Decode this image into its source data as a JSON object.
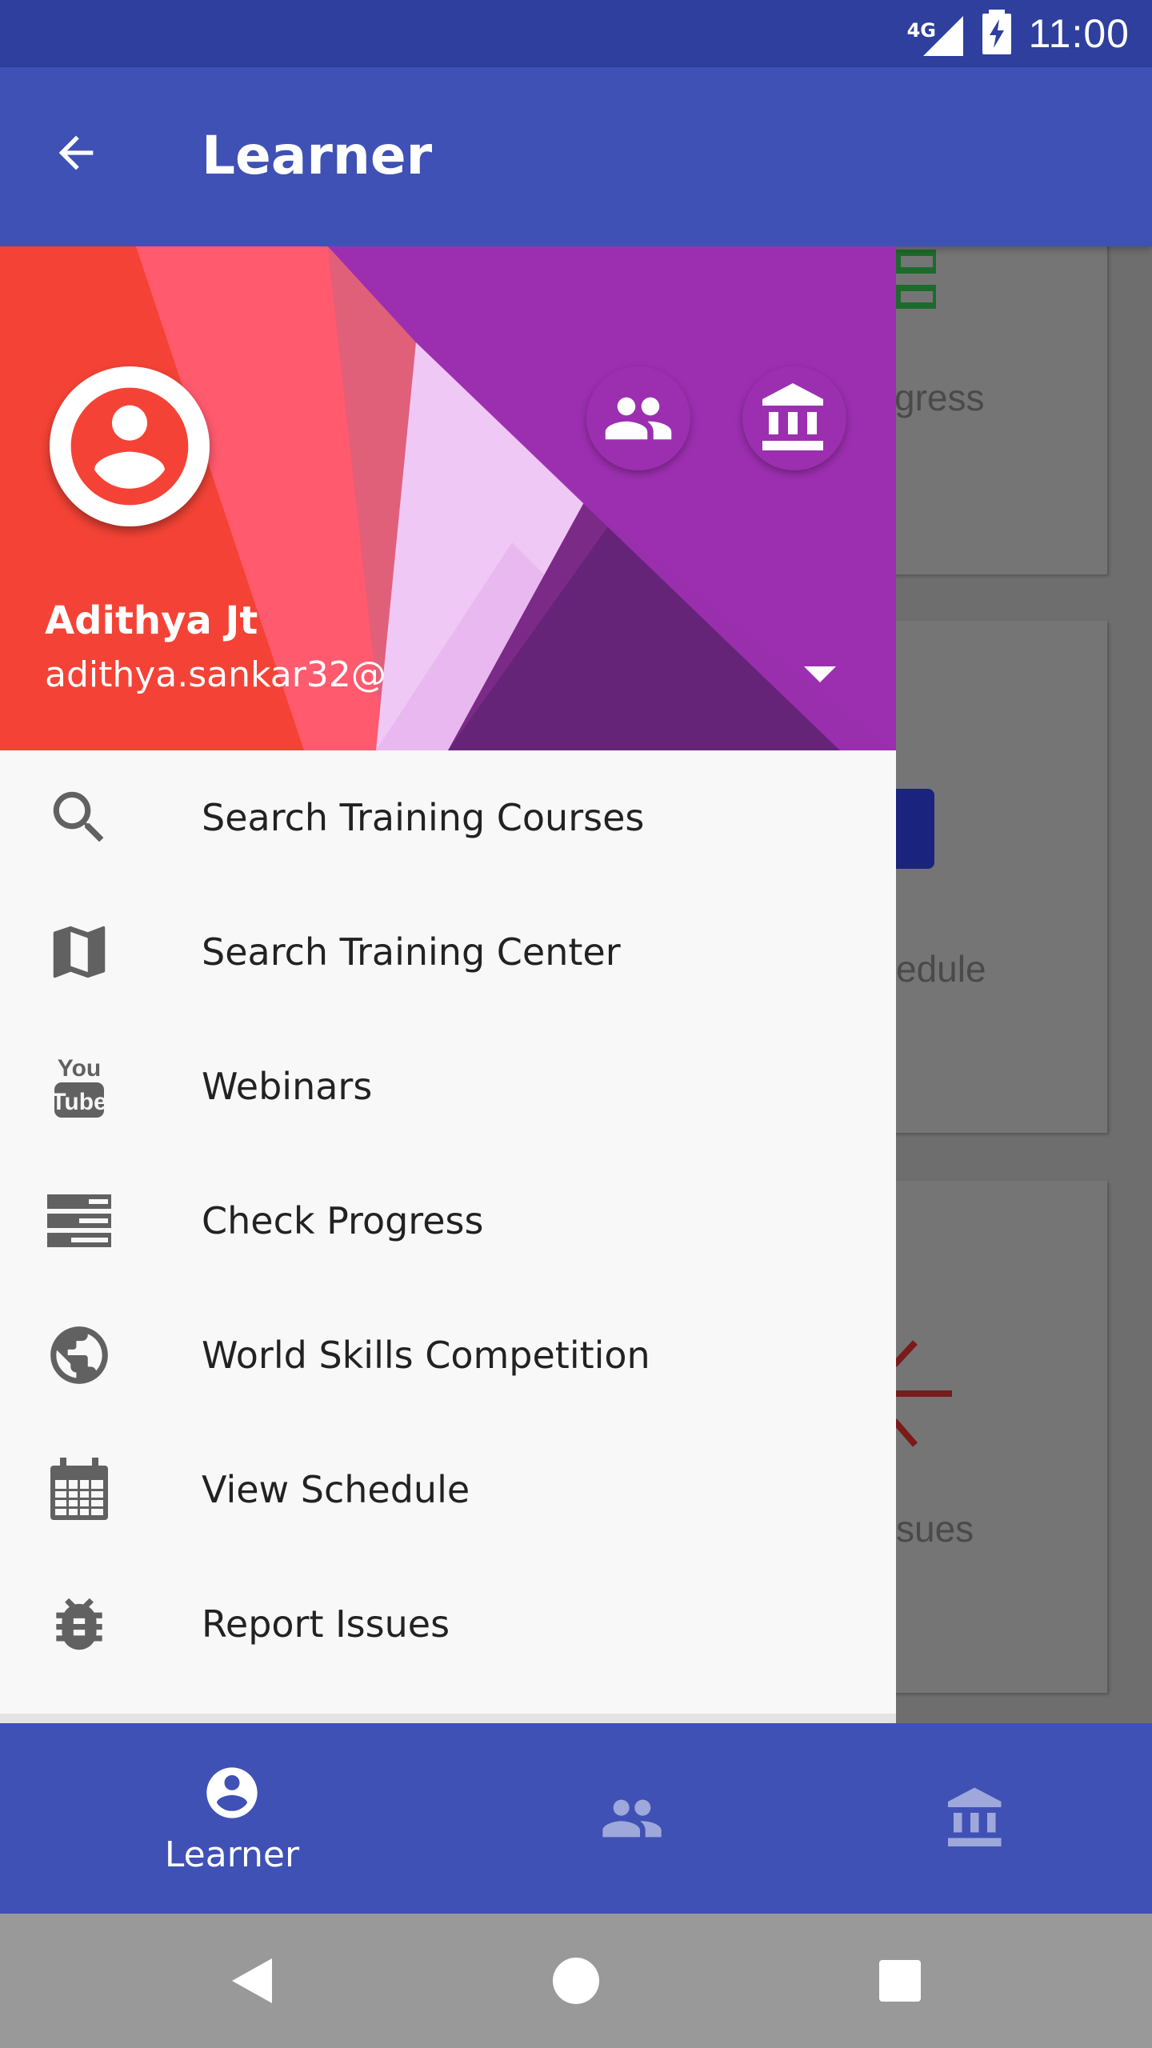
{
  "status_bar": {
    "network": "4G",
    "time": "11:00"
  },
  "app_bar": {
    "title": "Learner"
  },
  "background_cards": [
    {
      "label": "gress"
    },
    {
      "label": "edule"
    },
    {
      "label": "sues"
    }
  ],
  "drawer": {
    "user": {
      "name": "Adithya Jt",
      "email": "adithya.sankar32@"
    },
    "menu": [
      {
        "label": "Search Training Courses",
        "icon": "search-icon"
      },
      {
        "label": "Search Training Center",
        "icon": "map-icon"
      },
      {
        "label": "Webinars",
        "icon": "youtube-icon"
      },
      {
        "label": "Check Progress",
        "icon": "progress-list-icon"
      },
      {
        "label": "World Skills Competition",
        "icon": "globe-icon"
      },
      {
        "label": "View Schedule",
        "icon": "calendar-icon"
      },
      {
        "label": "Report Issues",
        "icon": "bug-icon"
      }
    ]
  },
  "bottom_nav": {
    "tabs": [
      {
        "label": "Learner",
        "icon": "person-icon",
        "active": true
      },
      {
        "label": "",
        "icon": "group-icon",
        "active": false
      },
      {
        "label": "",
        "icon": "institution-icon",
        "active": false
      }
    ]
  },
  "colors": {
    "primary": "#3f51b5",
    "primary_dark": "#2e3f9e",
    "accent_purple": "#9c27b0",
    "accent_red": "#f44336",
    "drawer_bg": "#f8f8f8"
  }
}
